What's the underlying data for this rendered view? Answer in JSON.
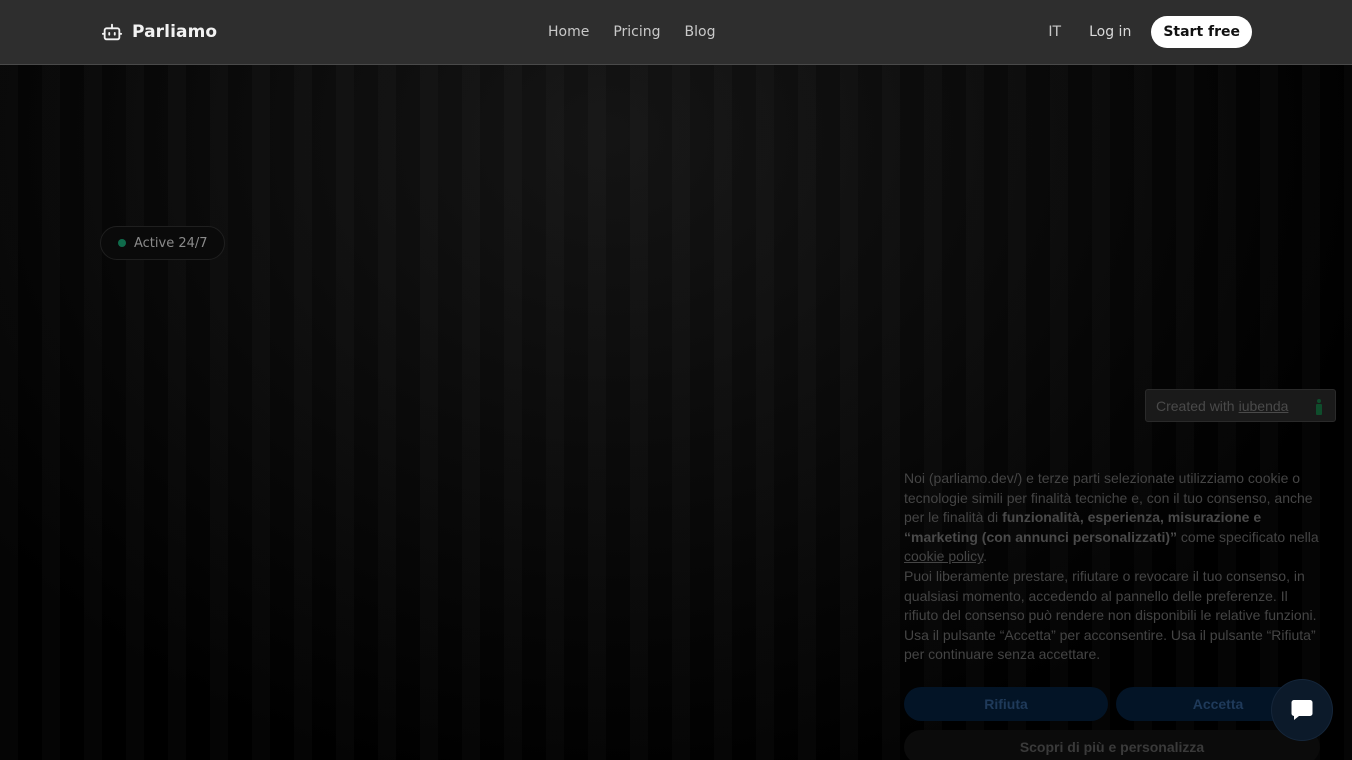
{
  "header": {
    "brand": "Parliamo",
    "nav": [
      "Home",
      "Pricing",
      "Blog"
    ],
    "lang": "IT",
    "login": "Log in",
    "cta": "Start free"
  },
  "hero": {
    "badge": "Active 24/7"
  },
  "iubenda": {
    "created_with": "Created with",
    "brand": "iubenda"
  },
  "cookie": {
    "p1_a": "Noi (parliamo.dev/) e terze parti selezionate utilizziamo cookie o tecnologie simili per finalità tecniche e, con il tuo consenso, anche per le finalità di ",
    "p1_bold": "funzionalità, esperienza, misurazione e “marketing (con annunci personalizzati)”",
    "p1_b": " come specificato nella ",
    "p1_link": "cookie policy",
    "p1_end": ".",
    "p2": "Puoi liberamente prestare, rifiutare o revocare il tuo consenso, in qualsiasi momento, accedendo al pannello delle preferenze. Il rifiuto del consenso può rendere non disponibili le relative funzioni. Usa il pulsante “Accetta” per acconsentire. Usa il pulsante “Rifiuta” per continuare senza accettare.",
    "reject": "Rifiuta",
    "accept": "Accetta",
    "more": "Scopri di più e personalizza"
  },
  "colors": {
    "header_bg": "#2e2e2e",
    "badge_dot": "#0f6b4b",
    "cta_bg": "#ffffff"
  }
}
